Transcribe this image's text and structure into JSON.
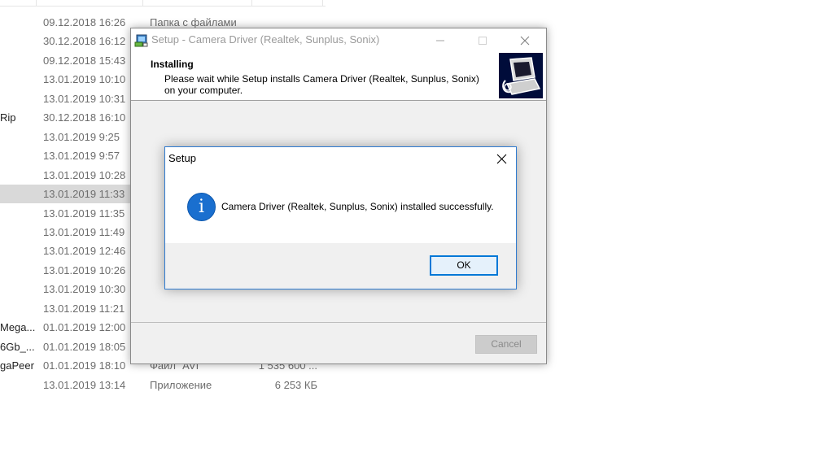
{
  "explorer": {
    "rows": [
      {
        "name": "",
        "date": "09.12.2018 16:26",
        "type": "Папка с файлами",
        "size": ""
      },
      {
        "name": "",
        "date": "30.12.2018 16:12",
        "type": "",
        "size": ""
      },
      {
        "name": "",
        "date": "09.12.2018 15:43",
        "type": "",
        "size": ""
      },
      {
        "name": "",
        "date": "13.01.2019 10:10",
        "type": "",
        "size": ""
      },
      {
        "name": "",
        "date": "13.01.2019 10:31",
        "type": "",
        "size": ""
      },
      {
        "name": "Rip",
        "date": "30.12.2018 16:10",
        "type": "",
        "size": ""
      },
      {
        "name": "",
        "date": "13.01.2019 9:25",
        "type": "",
        "size": ""
      },
      {
        "name": "",
        "date": "13.01.2019 9:57",
        "type": "",
        "size": ""
      },
      {
        "name": "",
        "date": "13.01.2019 10:28",
        "type": "",
        "size": ""
      },
      {
        "name": "",
        "date": "13.01.2019 11:33",
        "type": "",
        "size": "",
        "selected": true
      },
      {
        "name": "",
        "date": "13.01.2019 11:35",
        "type": "",
        "size": ""
      },
      {
        "name": "",
        "date": "13.01.2019 11:49",
        "type": "",
        "size": ""
      },
      {
        "name": "",
        "date": "13.01.2019 12:46",
        "type": "",
        "size": ""
      },
      {
        "name": "",
        "date": "13.01.2019 10:26",
        "type": "",
        "size": ""
      },
      {
        "name": "",
        "date": "13.01.2019 10:30",
        "type": "",
        "size": ""
      },
      {
        "name": "",
        "date": "13.01.2019 11:21",
        "type": "",
        "size": ""
      },
      {
        "name": "Mega...",
        "date": "01.01.2019 12:00",
        "type": "",
        "size": ""
      },
      {
        "name": "6Gb_...",
        "date": "01.01.2019 18:05",
        "type": "",
        "size": ""
      },
      {
        "name": "gaPeer",
        "date": "01.01.2019 18:10",
        "type": "Файл \"AVI\"",
        "size": "1 535 600 ..."
      },
      {
        "name": "",
        "date": "13.01.2019 13:14",
        "type": "Приложение",
        "size": "6 253 КБ"
      }
    ]
  },
  "wizard": {
    "title": "Setup - Camera Driver (Realtek, Sunplus, Sonix)",
    "heading": "Installing",
    "subheading": "Please wait while Setup installs Camera Driver (Realtek, Sunplus, Sonix) on your computer.",
    "cancel_label": "Cancel",
    "icons": {
      "minimize": "minimize-icon",
      "maximize": "maximize-icon",
      "close": "close-icon"
    }
  },
  "msgbox": {
    "title": "Setup",
    "message": "Camera Driver (Realtek, Sunplus, Sonix) installed successfully.",
    "ok_label": "OK",
    "icon": "info-icon",
    "accent_color": "#0078d7"
  }
}
